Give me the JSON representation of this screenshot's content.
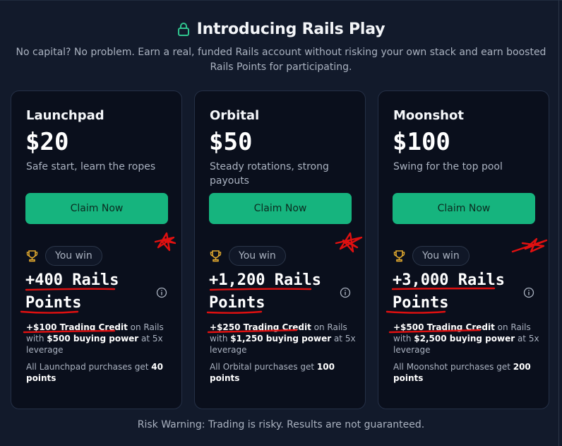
{
  "header": {
    "title": "Introducing Rails Play",
    "subtitle": "No capital? No problem. Earn a real, funded Rails account without risking your own stack and earn boosted Rails Points for participating."
  },
  "cards": [
    {
      "name": "Launchpad",
      "price": "$20",
      "desc": "Safe start, learn the ropes",
      "cta": "Claim Now",
      "win_label": "You win",
      "points_line1": "+400 Rails",
      "points_line2": "Points",
      "credit_amount": "+$100 Trading Credit",
      "credit_mid": " on Rails with ",
      "buying_power": "$500 buying power",
      "credit_end": " at 5x leverage",
      "bonus_text": "All Launchpad purchases get ",
      "bonus_points": "40 points"
    },
    {
      "name": "Orbital",
      "price": "$50",
      "desc": "Steady rotations, strong payouts",
      "cta": "Claim Now",
      "win_label": "You win",
      "points_line1": "+1,200 Rails",
      "points_line2": "Points",
      "credit_amount": "+$250 Trading Credit",
      "credit_mid": " on Rails with ",
      "buying_power": "$1,250 buying power",
      "credit_end": " at 5x leverage",
      "bonus_text": "All Orbital purchases get ",
      "bonus_points": "100 points"
    },
    {
      "name": "Moonshot",
      "price": "$100",
      "desc": "Swing for the top pool",
      "cta": "Claim Now",
      "win_label": "You win",
      "points_line1": "+3,000 Rails",
      "points_line2": "Points",
      "credit_amount": "+$500 Trading Credit",
      "credit_mid": " on Rails with ",
      "buying_power": "$2,500 buying power",
      "credit_end": " at 5x leverage",
      "bonus_text": "All Moonshot purchases get ",
      "bonus_points": "200 points"
    }
  ],
  "footer": {
    "warning": "Risk Warning: Trading is risky. Results are not guaranteed."
  },
  "icons": {
    "title": "lock-icon",
    "win": "trophy-icon",
    "info": "info-icon"
  },
  "colors": {
    "background": "#121a2b",
    "card": "#0a0f1c",
    "accent": "#16b47e",
    "lock": "#2fc58e",
    "trophy": "#e0a82e",
    "annotation": "#e01010"
  }
}
